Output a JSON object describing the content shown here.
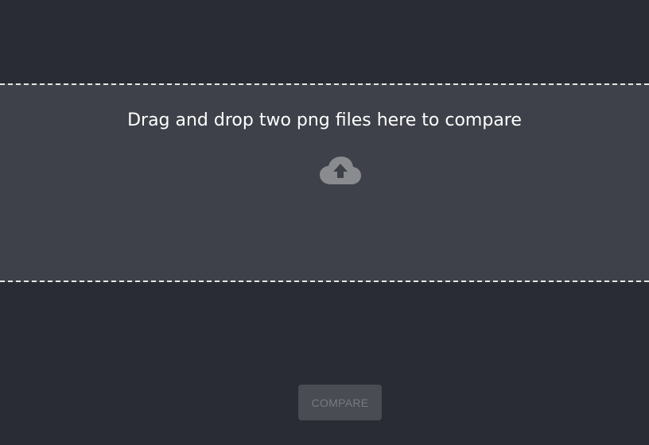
{
  "dropzone": {
    "instruction": "Drag and drop two png files here to compare",
    "icon": "cloud-upload-icon"
  },
  "actions": {
    "compare_label": "COMPARE",
    "compare_enabled": false
  },
  "colors": {
    "background": "#292c34",
    "dropzone_background": "#3e4149",
    "dropzone_border": "#e6e6e6",
    "icon": "#8a8b8f",
    "button_background": "#4a4c53",
    "button_text": "#777980"
  }
}
